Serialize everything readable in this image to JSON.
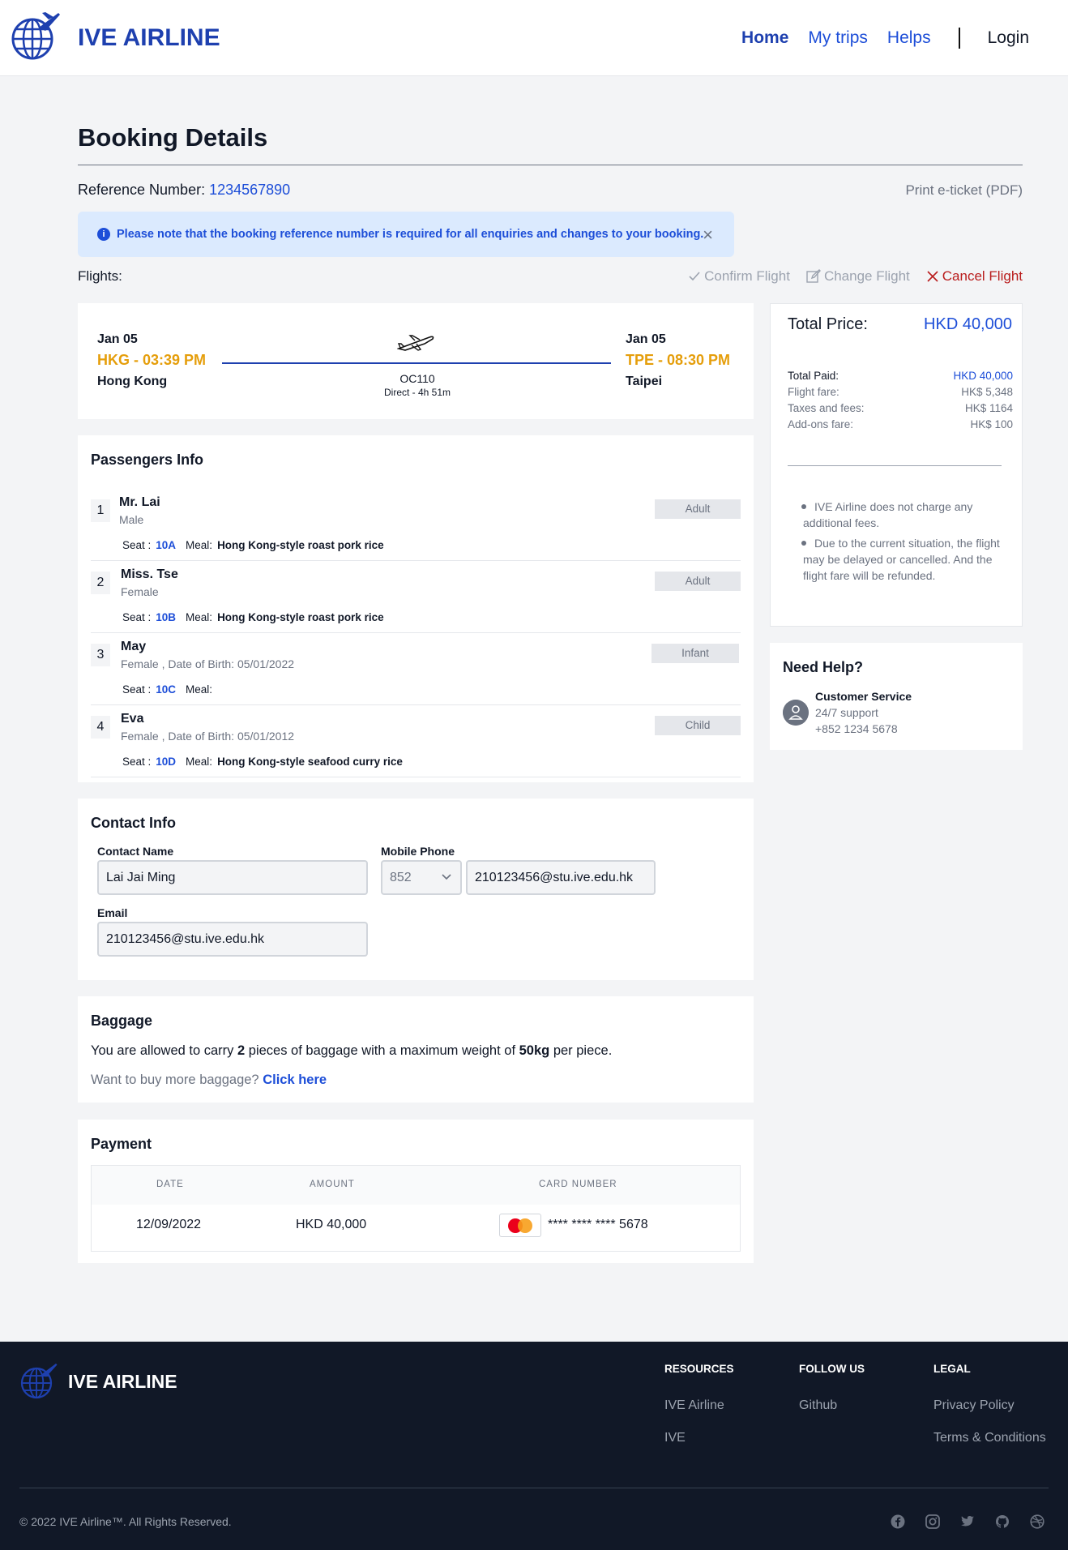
{
  "header": {
    "brand": "IVE AIRLINE",
    "nav": {
      "home": "Home",
      "trips": "My trips",
      "helps": "Helps",
      "login": "Login"
    }
  },
  "page": {
    "title": "Booking Details",
    "ref_label": "Reference Number: ",
    "ref_number": "1234567890",
    "print": "Print e-ticket (PDF)",
    "notice": "Please note that the booking reference number is required for all enquiries and changes to your booking.",
    "flights_label": "Flights:",
    "actions": {
      "confirm": "Confirm Flight",
      "change": "Change Flight",
      "cancel": "Cancel Flight"
    }
  },
  "flight": {
    "dep_date": "Jan 05",
    "dep_time": "HKG - 03:39 PM",
    "dep_city": "Hong Kong",
    "arr_date": "Jan 05",
    "arr_time": "TPE - 08:30 PM",
    "arr_city": "Taipei",
    "number": "OC110",
    "duration": "Direct - 4h 51m"
  },
  "price": {
    "total_label": "Total Price:",
    "total": "HKD 40,000",
    "rows": [
      {
        "k": "Total Paid:",
        "v": "HKD 40,000"
      },
      {
        "k": "Flight fare:",
        "v": "HK$ 5,348"
      },
      {
        "k": "Taxes and fees:",
        "v": "HK$ 1164"
      },
      {
        "k": "Add-ons fare:",
        "v": "HK$ 100"
      }
    ],
    "notes": [
      "IVE Airline does not charge any additional fees.",
      "Due to the current situation, the flight may be delayed or cancelled. And the flight fare will be refunded."
    ]
  },
  "help": {
    "title": "Need Help?",
    "name": "Customer Service",
    "line1": "24/7 support",
    "line2": "+852 1234 5678"
  },
  "passengers": {
    "title": "Passengers Info",
    "seat_label": "Seat :",
    "meal_label": "Meal:",
    "list": [
      {
        "num": "1",
        "name": "Mr. Lai",
        "sub": "Male",
        "type": "Adult",
        "seat": "10A",
        "meal": "Hong Kong-style roast pork rice"
      },
      {
        "num": "2",
        "name": "Miss. Tse",
        "sub": "Female",
        "type": "Adult",
        "seat": "10B",
        "meal": "Hong Kong-style roast pork rice"
      },
      {
        "num": "3",
        "name": "May",
        "sub": "Female , Date of Birth: 05/01/2022",
        "type": "Infant",
        "seat": "10C",
        "meal": ""
      },
      {
        "num": "4",
        "name": "Eva",
        "sub": "Female , Date of Birth: 05/01/2012",
        "type": "Child",
        "seat": "10D",
        "meal": "Hong Kong-style seafood curry rice"
      }
    ]
  },
  "contact": {
    "title": "Contact Info",
    "name_label": "Contact Name",
    "name_value": "Lai Jai Ming",
    "phone_label": "Mobile Phone",
    "phone_code": "852",
    "phone_value": "210123456@stu.ive.edu.hk",
    "email_label": "Email",
    "email_value": "210123456@stu.ive.edu.hk"
  },
  "baggage": {
    "title": "Baggage",
    "t1": "You are allowed to carry ",
    "pieces": "2",
    "t2": " pieces of baggage with a maximum weight of ",
    "weight": "50kg",
    "t3": " per piece.",
    "more": "Want to buy more baggage? ",
    "more_link": "Click here"
  },
  "payment": {
    "title": "Payment",
    "headers": {
      "date": "DATE",
      "amount": "AMOUNT",
      "card": "CARD NUMBER"
    },
    "row": {
      "date": "12/09/2022",
      "amount": "HKD 40,000",
      "card": "**** **** **** 5678"
    }
  },
  "footer": {
    "brand": "IVE AIRLINE",
    "resources": {
      "title": "RESOURCES",
      "l1": "IVE Airline",
      "l2": "IVE"
    },
    "follow": {
      "title": "FOLLOW US",
      "l1": "Github"
    },
    "legal": {
      "title": "LEGAL",
      "l1": "Privacy Policy",
      "l2": "Terms & Conditions"
    },
    "copyright": "© 2022 IVE Airline™. All Rights Reserved.",
    "social_icons": [
      "facebook-icon",
      "instagram-icon",
      "twitter-icon",
      "github-icon",
      "dribbble-icon"
    ]
  },
  "colors": {
    "brand": "#1e40af",
    "accent": "#1d4ed8",
    "time": "#e59e0b",
    "cancel": "#b91c1c",
    "footer_bg": "#111827"
  }
}
